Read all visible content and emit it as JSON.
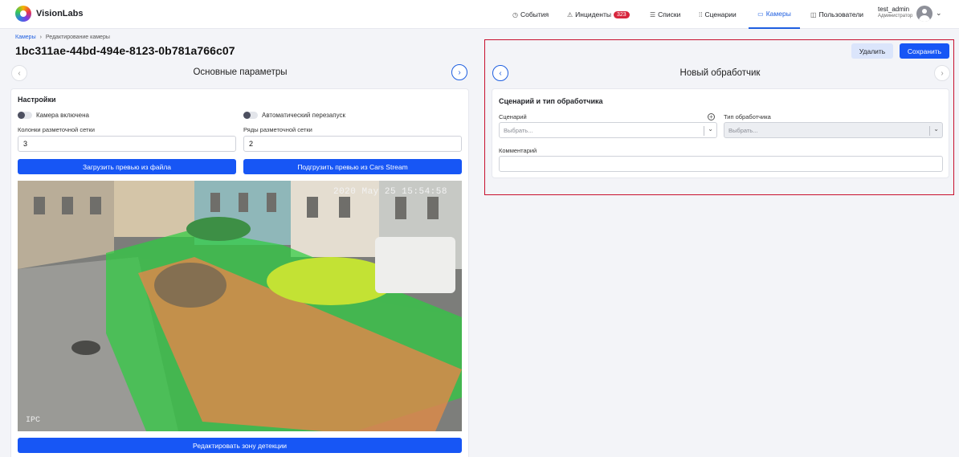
{
  "app": {
    "logo_text": "VisionLabs"
  },
  "nav": {
    "items": [
      {
        "label": "События",
        "icon": "clock-icon",
        "glyph": "◷"
      },
      {
        "label": "Инциденты",
        "icon": "warning-icon",
        "glyph": "⚠",
        "badge": "323"
      },
      {
        "label": "Списки",
        "icon": "list-icon",
        "glyph": "☰"
      },
      {
        "label": "Сценарии",
        "icon": "grid-icon",
        "glyph": "⁞⁞"
      },
      {
        "label": "Камеры",
        "icon": "camera-icon",
        "glyph": "▭"
      },
      {
        "label": "Пользователи",
        "icon": "users-icon",
        "glyph": "◫"
      }
    ],
    "active_index": 4
  },
  "user": {
    "name": "test_admin",
    "role": "Администратор"
  },
  "breadcrumb": {
    "root": "Камеры",
    "separator": "›",
    "current": "Редактирование камеры"
  },
  "page_title": "1bc311ae-44bd-494e-8123-0b781a766c07",
  "left": {
    "section_title": "Основные параметры",
    "settings": {
      "heading": "Настройки",
      "toggle_camera": "Камера включена",
      "toggle_restart": "Автоматический перезапуск",
      "grid_cols_label": "Колонки разметочной сетки",
      "grid_cols_value": "3",
      "grid_rows_label": "Ряды разметочной сетки",
      "grid_rows_value": "2",
      "upload_file_button": "Загрузить превью из файла",
      "cars_stream_button": "Подгрузить превью из Cars Stream",
      "edit_zone_button": "Редактировать зону детекции"
    },
    "preview": {
      "timestamp": "2020 May 25 15:54:58",
      "cam_tag": "IPC"
    }
  },
  "right": {
    "delete_button": "Удалить",
    "save_button": "Сохранить",
    "handler_title": "Новый обработчик",
    "card_heading": "Сценарий и тип обработчика",
    "scenario_label": "Сценарий",
    "scenario_placeholder": "Выбрать...",
    "handler_type_label": "Тип обработчика",
    "handler_type_placeholder": "Выбрать...",
    "comment_label": "Комментарий",
    "comment_value": ""
  },
  "colors": {
    "accent": "#1756f5",
    "highlight_border": "#c8102e",
    "zone_green": "#2ecc40",
    "zone_orange": "#d98a4a"
  }
}
